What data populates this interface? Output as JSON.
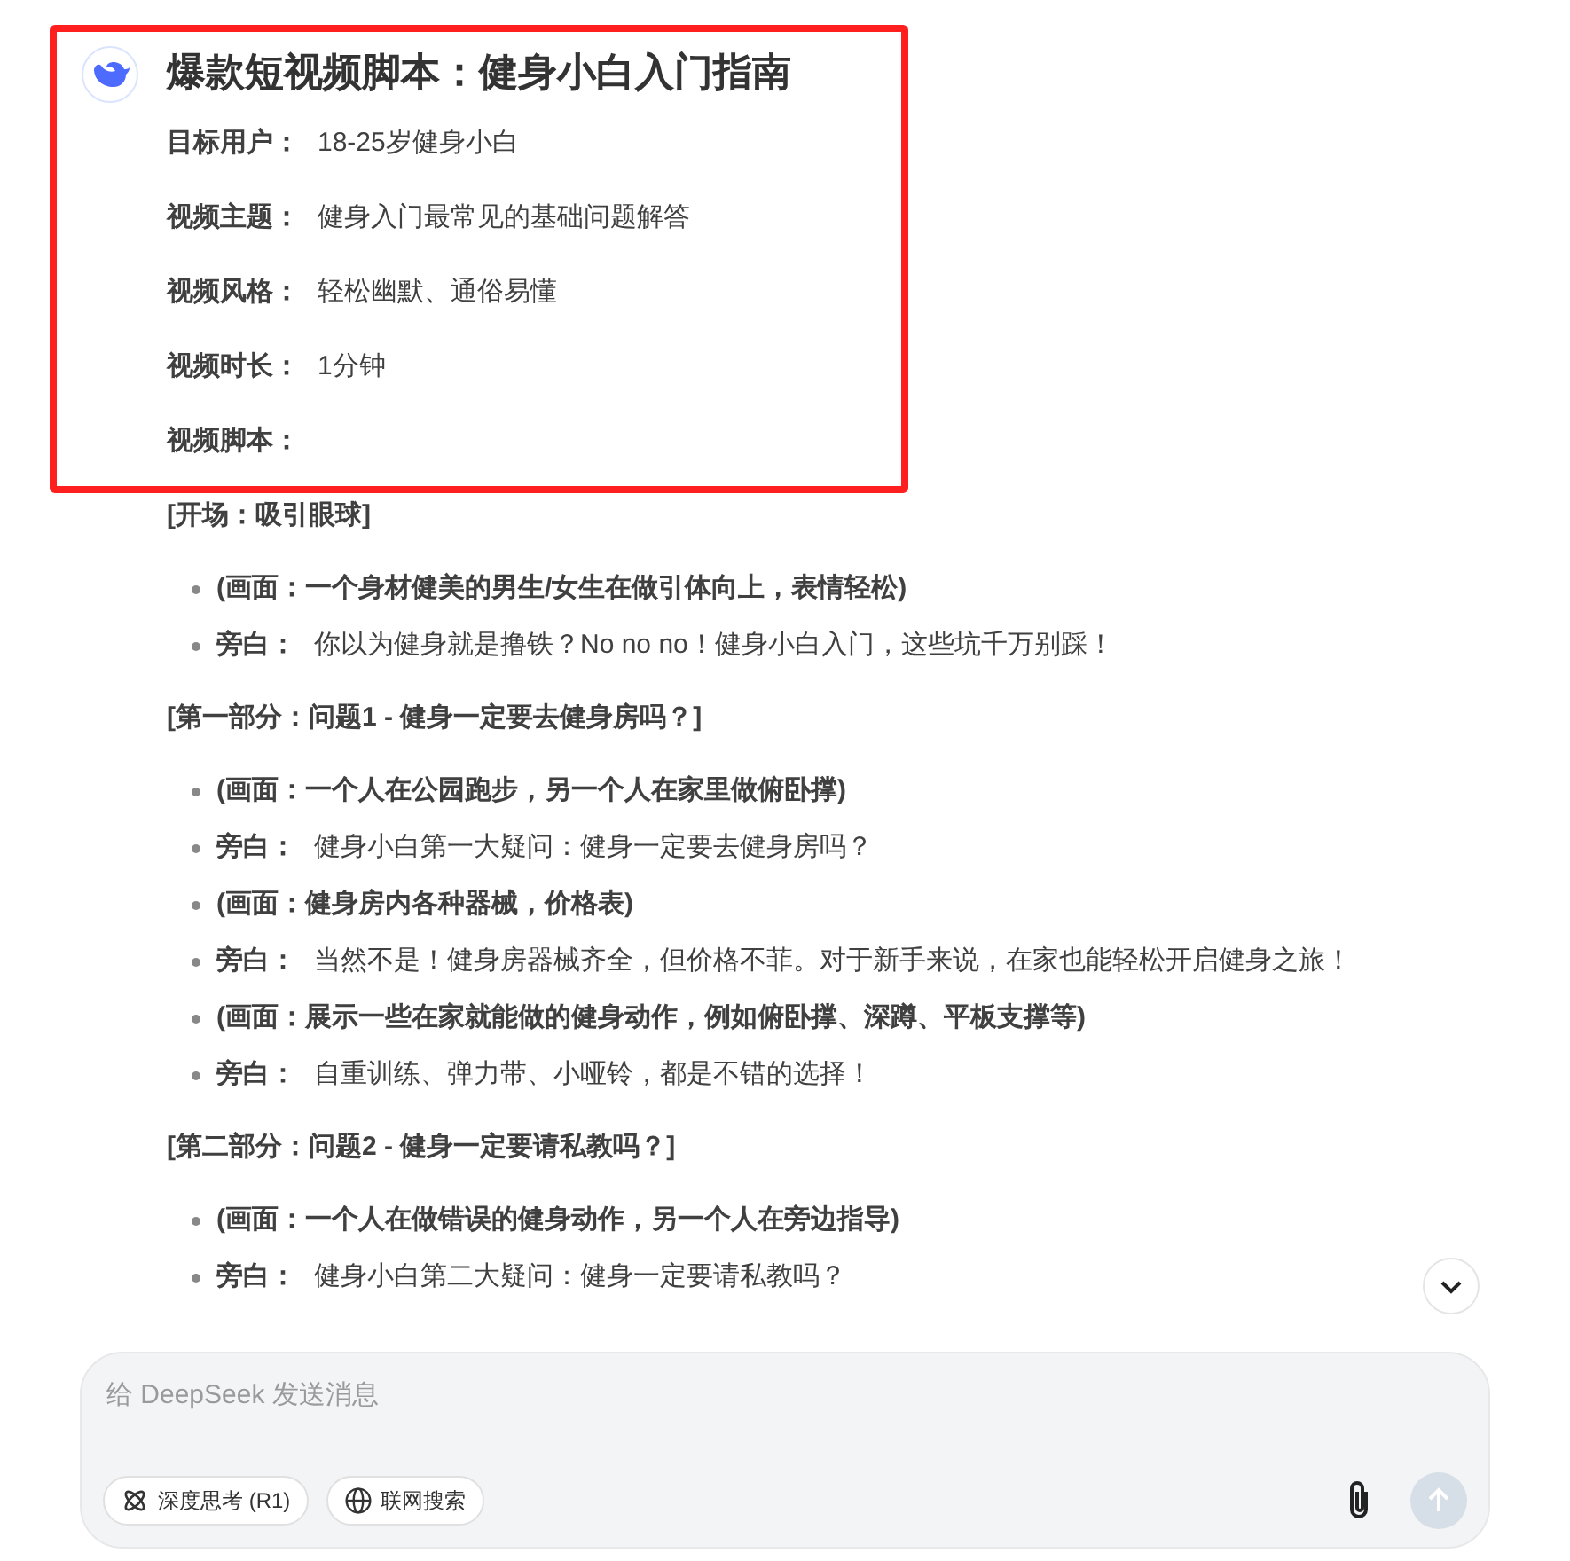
{
  "message": {
    "title": "爆款短视频脚本：健身小白入门指南",
    "highlighted": true,
    "fields": [
      {
        "label": "目标用户：",
        "value": "18-25岁健身小白"
      },
      {
        "label": "视频主题：",
        "value": "健身入门最常见的基础问题解答"
      },
      {
        "label": "视频风格：",
        "value": "轻松幽默、通俗易懂"
      },
      {
        "label": "视频时长：",
        "value": "1分钟"
      },
      {
        "label": "视频脚本："
      }
    ],
    "sections": [
      {
        "heading": "[开场：吸引眼球]",
        "items": [
          {
            "kind": "scene",
            "text": "(画面：一个身材健美的男生/女生在做引体向上，表情轻松)"
          },
          {
            "kind": "narration",
            "label": "旁白：",
            "text": "你以为健身就是撸铁？No no no！健身小白入门，这些坑千万别踩！"
          }
        ]
      },
      {
        "heading": "[第一部分：问题1 - 健身一定要去健身房吗？]",
        "items": [
          {
            "kind": "scene",
            "text": "(画面：一个人在公园跑步，另一个人在家里做俯卧撑)"
          },
          {
            "kind": "narration",
            "label": "旁白：",
            "text": "健身小白第一大疑问：健身一定要去健身房吗？"
          },
          {
            "kind": "scene",
            "text": "(画面：健身房内各种器械，价格表)"
          },
          {
            "kind": "narration",
            "label": "旁白：",
            "text": "当然不是！健身房器械齐全，但价格不菲。对于新手来说，在家也能轻松开启健身之旅！"
          },
          {
            "kind": "scene",
            "text": "(画面：展示一些在家就能做的健身动作，例如俯卧撑、深蹲、平板支撑等)"
          },
          {
            "kind": "narration",
            "label": "旁白：",
            "text": "自重训练、弹力带、小哑铃，都是不错的选择！"
          }
        ]
      },
      {
        "heading": "[第二部分：问题2 - 健身一定要请私教吗？]",
        "items": [
          {
            "kind": "scene",
            "text": "(画面：一个人在做错误的健身动作，另一个人在旁边指导)"
          },
          {
            "kind": "narration",
            "label": "旁白：",
            "text": "健身小白第二大疑问：健身一定要请私教吗？"
          }
        ]
      }
    ]
  },
  "composer": {
    "placeholder": "给 DeepSeek 发送消息",
    "toggles": [
      {
        "kind": "think",
        "label": "深度思考 (R1)",
        "selected": false
      },
      {
        "kind": "search",
        "label": "联网搜索",
        "selected": false
      }
    ],
    "send_disabled": true
  }
}
